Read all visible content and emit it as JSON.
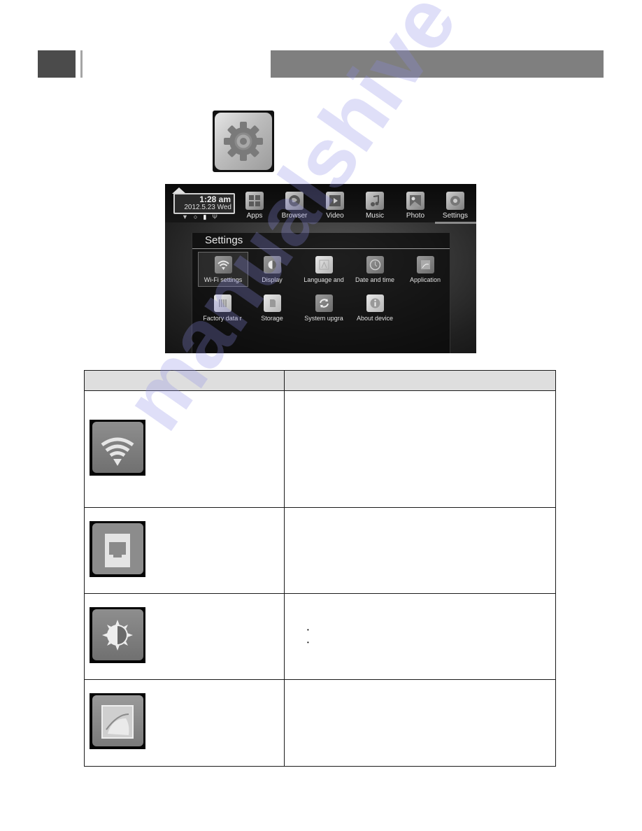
{
  "header": {
    "colors": {
      "square": "#4b4b4b",
      "divider": "#a5a5a5",
      "bar": "#7f7f7f"
    }
  },
  "settings_icon": {
    "icon": "gear-icon"
  },
  "device_screen": {
    "status": {
      "time": "1:28 am",
      "date": "2012.5.23",
      "weekday": "Wed",
      "icons": [
        "wifi-icon",
        "sync-icon",
        "sd-card-icon",
        "usb-icon"
      ]
    },
    "apps": [
      {
        "label": "Apps",
        "icon": "apps-grid-icon"
      },
      {
        "label": "Browser",
        "icon": "globe-icon"
      },
      {
        "label": "Video",
        "icon": "film-icon"
      },
      {
        "label": "Music",
        "icon": "music-note-icon"
      },
      {
        "label": "Photo",
        "icon": "photo-icon"
      },
      {
        "label": "Settings",
        "icon": "gear-icon",
        "selected": true
      }
    ],
    "settings_panel": {
      "title": "Settings",
      "items": [
        {
          "label": "Wi-Fi settings",
          "icon": "wifi-icon",
          "selected": true
        },
        {
          "label": "Display",
          "icon": "contrast-icon"
        },
        {
          "label": "Language and",
          "icon": "language-icon"
        },
        {
          "label": "Date and time",
          "icon": "clock-icon"
        },
        {
          "label": "Application",
          "icon": "application-icon"
        },
        {
          "label": "Factory data r",
          "icon": "factory-reset-icon"
        },
        {
          "label": "Storage",
          "icon": "sd-card-icon"
        },
        {
          "label": "System upgra",
          "icon": "refresh-icon"
        },
        {
          "label": "About device",
          "icon": "info-icon"
        }
      ]
    }
  },
  "table": {
    "headers": [
      "",
      ""
    ],
    "rows": [
      {
        "icon": "wifi-icon",
        "description": ""
      },
      {
        "icon": "ethernet-icon",
        "description": ""
      },
      {
        "icon": "brightness-icon",
        "description": "",
        "bullets": [
          "•",
          "•"
        ]
      },
      {
        "icon": "android-application-icon",
        "description": ""
      }
    ]
  },
  "watermark": {
    "text": "manualshive"
  }
}
